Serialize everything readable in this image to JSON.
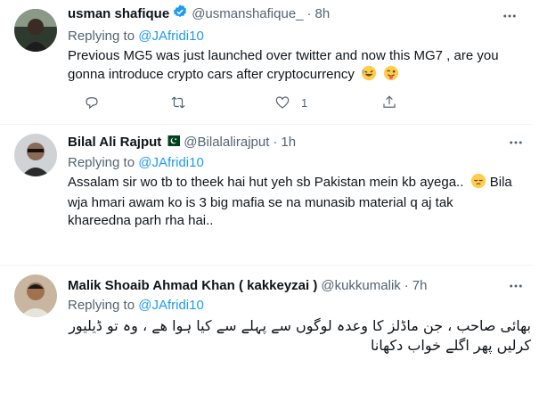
{
  "replies": [
    {
      "name": "usman shafique",
      "handle": "@usmanshafique_",
      "separator": "·",
      "time": "8h",
      "replying_prefix": "Replying to",
      "replying_to": "@JAfridi10",
      "text": "Previous MG5 was just  launched over twitter and now this MG7 , are you gonna introduce crypto cars after cryptocurrency",
      "emojis": [
        "rofl-emoji",
        "winking-tongue-emoji"
      ],
      "verified": true,
      "likes": "1"
    },
    {
      "name": "Bilal Ali Rajput",
      "handle": "@Bilalalirajput",
      "separator": "·",
      "time": "1h",
      "replying_prefix": "Replying to",
      "replying_to": "@JAfridi10",
      "text": "Assalam sir wo tb to theek hai hut yeh sb Pakistan mein kb ayega..",
      "text_after_emoji": "Bila wja hmari awam ko is 3 big mafia se na munasib material q aj tak khareedna parh rha hai..",
      "emojis": [
        "pensive-emoji"
      ],
      "flag": "pakistan-flag-icon"
    },
    {
      "name": "Malik Shoaib Ahmad Khan ( kakkeyzai )",
      "handle": "@kukkumalik",
      "separator": "·",
      "time": "7h",
      "replying_prefix": "Replying to",
      "replying_to": "@JAfridi10",
      "text": "بھائی صاحب ، جن ماڈلز کا وعدہ لوگوں  سے پہلے سے کیا ہوا ھے ، وہ تو ڈیلیور کرلیں پھر اگلے خواب دکھانا"
    }
  ],
  "colors": {
    "link": "#1d9bf0",
    "muted": "#536471",
    "text": "#0f1419",
    "divider": "#eff3f4",
    "verified": "#1d9bf0"
  },
  "icons": {
    "reply": "reply-icon",
    "retweet": "retweet-icon",
    "like": "heart-icon",
    "share": "share-icon",
    "more": "more-icon"
  }
}
